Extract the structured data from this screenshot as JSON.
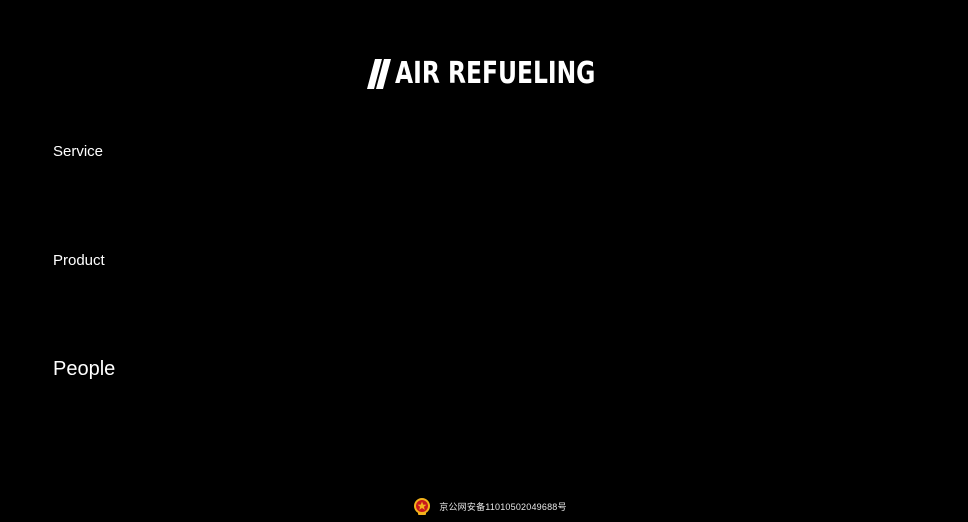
{
  "header": {
    "logo_text": "AIR REFUELING",
    "logo_mark": "double-slash-icon"
  },
  "nav": {
    "items": [
      {
        "label": "Service"
      },
      {
        "label": "Product"
      },
      {
        "label": "People"
      }
    ]
  },
  "footer": {
    "icon": "police-badge-icon",
    "record_text": "京公网安备11010502049688号"
  },
  "colors": {
    "background": "#000000",
    "text": "#ffffff",
    "badge_red": "#c8161d",
    "badge_gold": "#f2b21c"
  }
}
